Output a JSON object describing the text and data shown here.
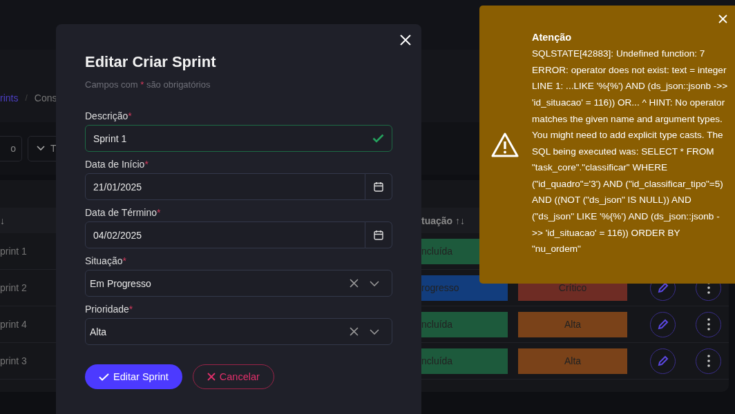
{
  "breadcrumb": {
    "current": "rints",
    "next": "Cons",
    "separator": "/"
  },
  "filters": [
    {
      "kind": "field",
      "text": "o"
    },
    {
      "kind": "dropdown",
      "text": "T"
    }
  ],
  "table": {
    "columns": [
      {
        "label": "↓"
      },
      {
        "label": "tuação ↑↓"
      }
    ],
    "rows": [
      {
        "name": "print 1",
        "status": {
          "label": "ncluída",
          "color": "#1d5a3c"
        }
      },
      {
        "name": "print 2",
        "status": {
          "label": "rogresso",
          "color": "#123d7d"
        },
        "priority": {
          "label": "Crítico",
          "color": "#6e2c24"
        }
      },
      {
        "name": "print 4",
        "status": {
          "label": "ncluída",
          "color": "#1d5a3c"
        },
        "priority": {
          "label": "Alta",
          "color": "#7a4219"
        }
      },
      {
        "name": "print 3",
        "status": {
          "label": "ncluída",
          "color": "#1d5a3c"
        },
        "priority": {
          "label": "Alta",
          "color": "#7a4219"
        }
      }
    ]
  },
  "modal": {
    "title": "Editar Criar Sprint",
    "subtitle_before": "Campos com",
    "subtitle_mark": "*",
    "subtitle_after": "são obrigatórios",
    "fields": [
      {
        "kind": "text",
        "label": "Descrição",
        "required": true,
        "value": "Sprint 1",
        "valid": true
      },
      {
        "kind": "date",
        "label": "Data de Início",
        "required": true,
        "value": "21/01/2025"
      },
      {
        "kind": "date",
        "label": "Data de Término",
        "required": true,
        "value": "04/02/2025"
      },
      {
        "kind": "select",
        "label": "Situação",
        "required": true,
        "value": "Em Progresso"
      },
      {
        "kind": "select",
        "label": "Prioridade",
        "required": true,
        "value": "Alta"
      }
    ],
    "buttons": [
      {
        "kind": "primary",
        "label": "Editar Sprint"
      },
      {
        "kind": "cancel",
        "label": "Cancelar"
      }
    ]
  },
  "toast": {
    "title": "Atenção",
    "message": "SQLSTATE[42883]: Undefined function: 7 ERROR: operator does not exist: text = integer LINE 1: ...LIKE '%{%') AND (ds_json::jsonb ->> 'id_situacao' = 116)) OR... ^ HINT: No operator matches the given name and argument types. You might need to add explicit type casts. The SQL being executed was: SELECT * FROM \"task_core\".\"classificar\" WHERE (\"id_quadro\"='3') AND (\"id_classificar_tipo\"=5) AND ((NOT (\"ds_json\" IS NULL)) AND (\"ds_json\" LIKE '%{%') AND (ds_json::jsonb ->> 'id_situacao' = 116)) ORDER BY \"nu_ordem\""
  }
}
